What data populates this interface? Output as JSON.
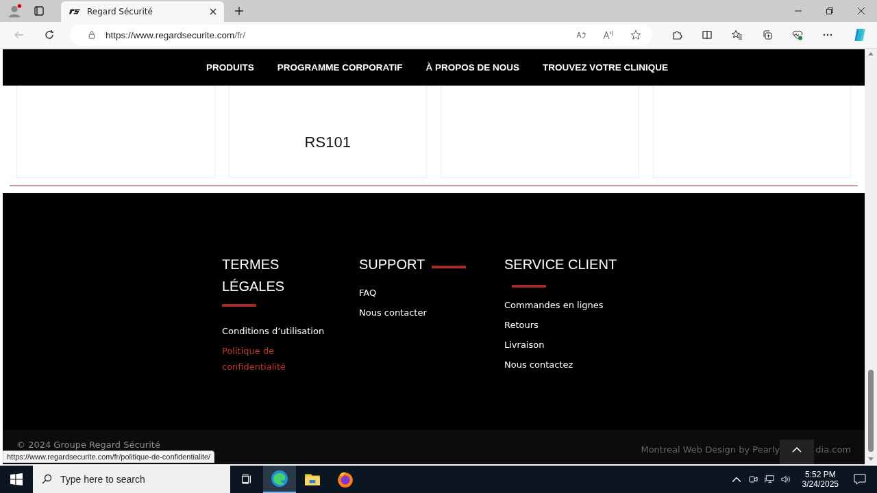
{
  "browser": {
    "tab_title": "Regard Sécurité",
    "url_host": "https://www.regardsecurite.com",
    "url_path": "/fr/"
  },
  "nav": [
    "PRODUITS",
    "PROGRAMME CORPORATIF",
    "À PROPOS DE NOUS",
    "TROUVEZ VOTRE CLINIQUE"
  ],
  "cards": [
    {
      "kind": "empty"
    },
    {
      "kind": "labeled",
      "label": "RS101"
    },
    {
      "kind": "empty"
    },
    {
      "kind": "empty"
    }
  ],
  "footer": {
    "columns": [
      {
        "title": "TERMES LÉGALES",
        "links": [
          {
            "text": "Conditions d’utilisation",
            "selected": false
          },
          {
            "text": "Politique de confidentialité",
            "selected": true
          }
        ]
      },
      {
        "title": "SUPPORT",
        "links": [
          {
            "text": "FAQ",
            "selected": false
          },
          {
            "text": "Nous contacter",
            "selected": false
          }
        ]
      },
      {
        "title": "SERVICE CLIENT",
        "links": [
          {
            "text": "Commandes en lignes",
            "selected": false
          },
          {
            "text": "Retours",
            "selected": false
          },
          {
            "text": "Livraison",
            "selected": false
          },
          {
            "text": "Nous contactez",
            "selected": false
          }
        ]
      }
    ],
    "copyright": "© 2024 Groupe Regard Sécurité",
    "credit_start": "Montreal Web Design by Pearly",
    "credit_end": "dia.com"
  },
  "status_url": "https://www.regardsecurite.com/fr/politique-de-confidentialite/",
  "taskbar": {
    "search_placeholder": "Type here to search",
    "time": "5:52 PM",
    "date": "3/24/2025"
  }
}
